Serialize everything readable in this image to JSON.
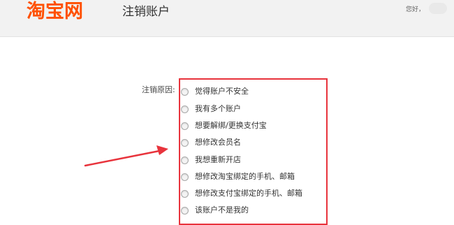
{
  "header": {
    "logo_text": "淘宝网",
    "page_title": "注销账户",
    "greeting": "您好，"
  },
  "form": {
    "reason_label": "注销原因:",
    "reasons": [
      "觉得账户不安全",
      "我有多个账户",
      "想要解绑/更换支付宝",
      "想修改会员名",
      "我想重新开店",
      "想修改淘宝绑定的手机、邮箱",
      "想修改支付宝绑定的手机、邮箱",
      "该账户不是我的"
    ]
  },
  "colors": {
    "brand": "#ff5000",
    "highlight_box": "#e8333c",
    "arrow": "#e8333c"
  },
  "icons": {
    "annotation_arrow": "arrow-right-icon",
    "radio": "radio-unchecked-icon"
  }
}
